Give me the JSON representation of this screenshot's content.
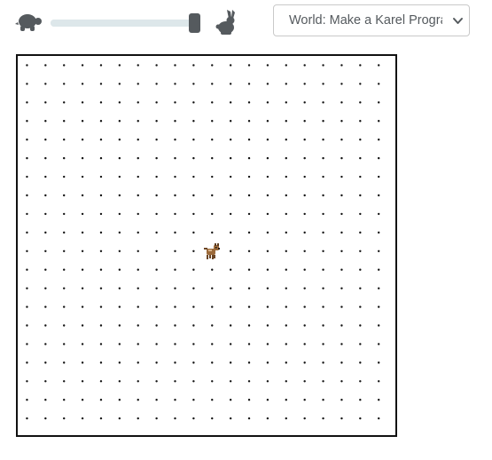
{
  "toolbar": {
    "slow_icon": "turtle-icon",
    "fast_icon": "rabbit-icon",
    "speed_level": 1.0
  },
  "world_select": {
    "label": "World: Make a Karel Program",
    "options_visible": [
      "World: Make a Karel Program"
    ]
  },
  "world": {
    "columns": 20,
    "rows": 20,
    "karel": {
      "col": 11,
      "row": 10,
      "icon": "karel-dog-icon"
    }
  },
  "colors": {
    "slider_track": "#dde7ea",
    "slider_thumb": "#555a5e",
    "icon": "#555a5e",
    "world_border": "#111111",
    "corner_dot": "#111111"
  }
}
